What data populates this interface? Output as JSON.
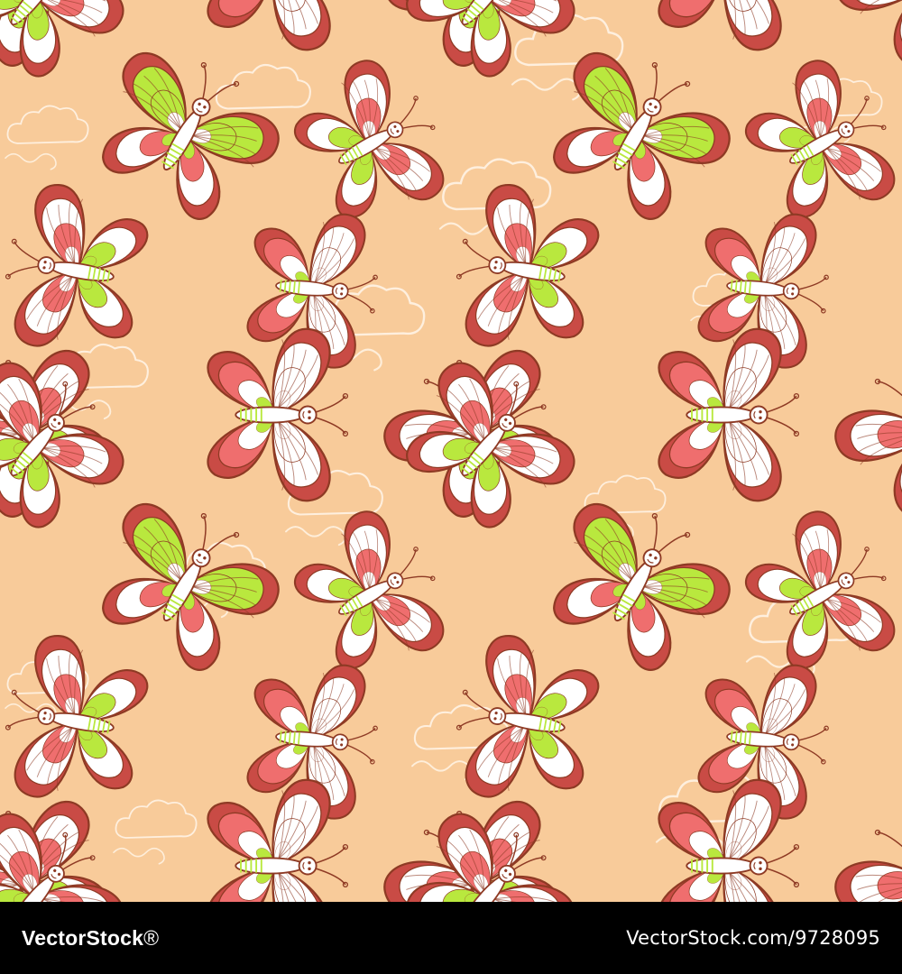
{
  "image": {
    "subject": "seamless-pattern",
    "motif_icons": [
      "butterfly-icon",
      "cloud-icon",
      "swirl-icon"
    ],
    "colors": {
      "background": "#F8CB9A",
      "cloud_line": "#FFF6EA",
      "wing_red": "#EF6E6E",
      "wing_green": "#B9E83E",
      "wing_white": "#FFFFFF",
      "outline": "#8E3A24",
      "wing_edge": "#C94B45",
      "footer": "#000000"
    }
  },
  "footer": {
    "brand": "VectorStock",
    "brand_suffix": "®",
    "stock_id": "VectorStock.com/9728095"
  }
}
